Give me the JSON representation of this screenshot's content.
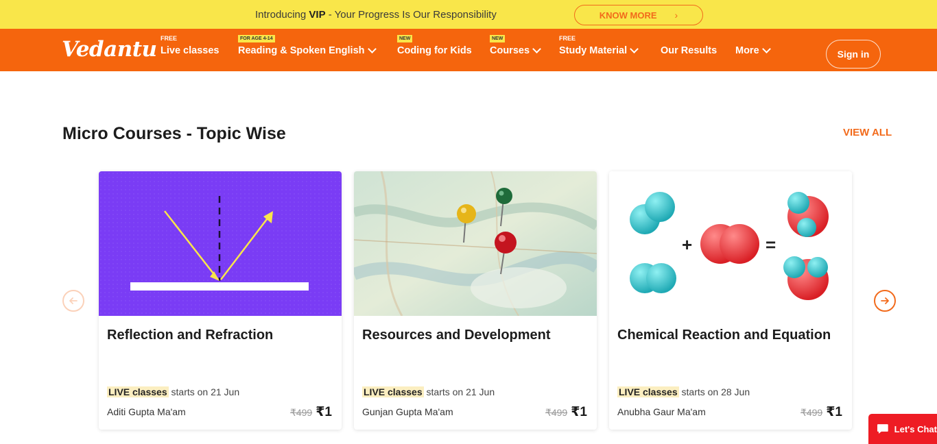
{
  "promo": {
    "text_pre": "Introducing ",
    "text_bold": "VIP",
    "text_post": " - Your Progress Is Our Responsibility",
    "button_label": "KNOW MORE",
    "button_chevron": "›"
  },
  "nav": {
    "logo": "Vedantu",
    "items": [
      {
        "tag": "FREE",
        "label": "Live classes"
      },
      {
        "tag": "FOR AGE 4-14",
        "label": "Reading & Spoken English"
      },
      {
        "tag": "NEW",
        "label": "Coding for Kids"
      },
      {
        "tag": "NEW",
        "label": "Courses"
      },
      {
        "tag": "FREE",
        "label": "Study Material"
      },
      {
        "tag": "",
        "label": "Our Results"
      },
      {
        "tag": "",
        "label": "More"
      }
    ],
    "signin": "Sign in"
  },
  "section": {
    "title": "Micro Courses - Topic Wise",
    "view_all": "VIEW ALL"
  },
  "cards": [
    {
      "title": "Reflection and Refraction",
      "live": "LIVE classes",
      "starts": " starts on 21 Jun",
      "teacher": "Aditi Gupta Ma'am",
      "old_price": "₹499",
      "price": "₹1"
    },
    {
      "title": "Resources and Development",
      "live": "LIVE classes",
      "starts": " starts on 21 Jun",
      "teacher": "Gunjan Gupta Ma'am",
      "old_price": "₹499",
      "price": "₹1"
    },
    {
      "title": "Chemical Reaction and Equation",
      "live": "LIVE classes",
      "starts": " starts on 28 Jun",
      "teacher": "Anubha Gaur Ma'am",
      "old_price": "₹499",
      "price": "₹1"
    }
  ],
  "chat": {
    "label": "Let's Chat"
  },
  "colors": {
    "accent": "#f5650d",
    "banner": "#f9e64a",
    "card1_bg": "#7a3cf5",
    "chat": "#ee1c24"
  },
  "icons": {
    "prev": "arrow-left-icon",
    "next": "arrow-right-icon",
    "chat": "chat-bubble-icon"
  }
}
